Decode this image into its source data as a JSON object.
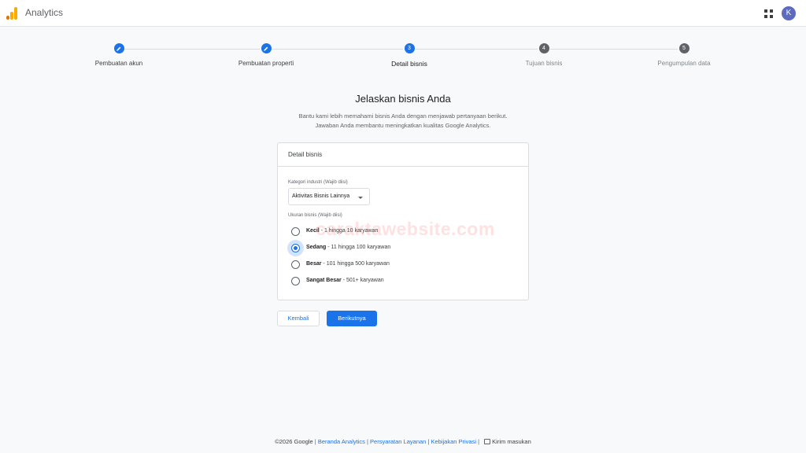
{
  "topbar": {
    "app_title": "Analytics",
    "avatar_initial": "K",
    "logo_icon": "analytics-bars-icon",
    "apps_icon": "grid-apps-icon"
  },
  "stepper": {
    "steps": [
      {
        "label": "Pembuatan akun",
        "state": "done",
        "icon": "pencil-icon"
      },
      {
        "label": "Pembuatan properti",
        "state": "done",
        "icon": "pencil-icon"
      },
      {
        "label": "Detail bisnis",
        "state": "current",
        "number": "3"
      },
      {
        "label": "Tujuan bisnis",
        "state": "todo",
        "number": "4"
      },
      {
        "label": "Pengumpulan data",
        "state": "todo",
        "number": "5"
      }
    ]
  },
  "main": {
    "title": "Jelaskan bisnis Anda",
    "subtitle_line1": "Bantu kami lebih memahami bisnis Anda dengan menjawab pertanyaan berikut.",
    "subtitle_line2": "Jawaban Anda membantu meningkatkan kualitas Google Analytics."
  },
  "card": {
    "title": "Detail bisnis",
    "industry_label": "Kategori industri (Wajib diisi)",
    "industry_value": "Aktivitas Bisnis Lainnya",
    "size_label": "Ukuran bisnis (Wajib diisi)",
    "sizes": [
      {
        "name": "Kecil",
        "detail": " - 1 hingga 10 karyawan",
        "checked": false
      },
      {
        "name": "Sedang",
        "detail": " - 11 hingga 100 karyawan",
        "checked": true
      },
      {
        "name": "Besar",
        "detail": " - 101 hingga 500 karyawan",
        "checked": false
      },
      {
        "name": "Sangat Besar",
        "detail": " - 501+ karyawan",
        "checked": false
      }
    ]
  },
  "watermark": "caraktawebsite.com",
  "buttons": {
    "back": "Kembali",
    "next": "Berikutnya"
  },
  "footer": {
    "copyright": "©2026 Google",
    "sep": "|",
    "link1": "Beranda Analytics",
    "link2": "Persyaratan Layanan",
    "link3": "Kebijakan Privasi",
    "feedback": "Kirim masukan"
  },
  "colors": {
    "accent": "#1a73e8",
    "inactive_step": "#5f6368",
    "logo_orange": "#e37400",
    "logo_yellow": "#f9ab00",
    "avatar": "#5c6bc0"
  }
}
